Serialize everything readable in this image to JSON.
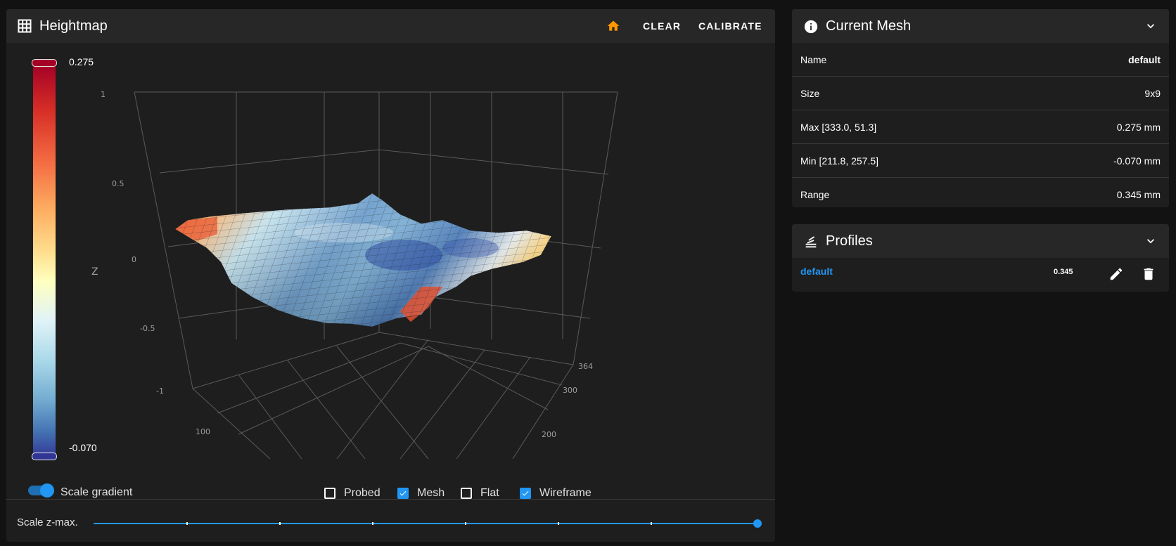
{
  "heightmap": {
    "title": "Heightmap",
    "actions": {
      "clear": "CLEAR",
      "calibrate": "CALIBRATE"
    },
    "colorbar": {
      "max_label": "0.275",
      "min_label": "-0.070"
    },
    "controls": {
      "scale_gradient": {
        "label": "Scale gradient",
        "checked": true
      },
      "probed": {
        "label": "Probed",
        "checked": false
      },
      "mesh": {
        "label": "Mesh",
        "checked": true
      },
      "flat": {
        "label": "Flat",
        "checked": false
      },
      "wireframe": {
        "label": "Wireframe",
        "checked": true
      }
    },
    "scale_zmax": {
      "label": "Scale z-max.",
      "value": 1.0
    },
    "colors": {
      "accent": "#2196f3",
      "home": "#ff9800"
    }
  },
  "current_mesh": {
    "title": "Current Mesh",
    "rows": [
      {
        "key": "Name",
        "value": "default"
      },
      {
        "key": "Size",
        "value": "9x9"
      },
      {
        "key": "Max [333.0, 51.3]",
        "value": "0.275 mm"
      },
      {
        "key": "Min [211.8, 257.5]",
        "value": "-0.070 mm"
      },
      {
        "key": "Range",
        "value": "0.345 mm"
      }
    ]
  },
  "profiles": {
    "title": "Profiles",
    "items": [
      {
        "name": "default",
        "range": "0.345"
      }
    ]
  },
  "chart_data": {
    "type": "surface",
    "zlabel": "Z",
    "z_ticks": [
      "1",
      "0.5",
      "0",
      "-0.5",
      "-1"
    ],
    "x_ticks": [
      "100"
    ],
    "y_ticks": [
      "200",
      "300",
      "364"
    ],
    "zlim": [
      -1,
      1
    ],
    "colorscale_range": [
      -0.07,
      0.275
    ]
  }
}
